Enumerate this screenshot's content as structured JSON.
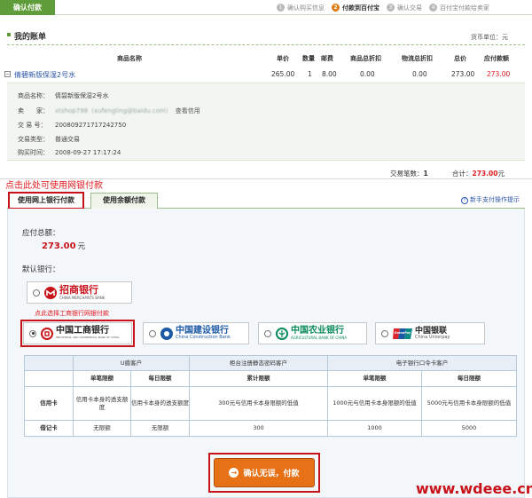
{
  "top": {
    "tab_label": "确认付款",
    "steps": [
      {
        "num": "1",
        "label": "确认购买信息",
        "active": false
      },
      {
        "num": "2",
        "label": "付款到百付宝",
        "active": true
      },
      {
        "num": "3",
        "label": "确认交易",
        "active": false
      },
      {
        "num": "4",
        "label": "百付宝付款给卖家",
        "active": false
      }
    ]
  },
  "bill": {
    "title": "我的账单",
    "currency": "货币单位：元",
    "headers": [
      "商品名称",
      "单价",
      "数量",
      "邮费",
      "商品总折扣",
      "物流总折扣",
      "总价",
      "应付款额"
    ],
    "row": {
      "expand": "−",
      "product": "倩碧新版保湿2号水",
      "price": "265.00",
      "qty": "1",
      "postage": "8.00",
      "goods_discount": "0.00",
      "logistics_discount": "0.00",
      "total": "273.00",
      "payable": "273.00"
    },
    "details": {
      "product_label": "商品名称：",
      "product_value": "倩碧新版保湿2号水",
      "seller_label": "卖　　家：",
      "seller_value": "xtshop798（xufengling@baidu.com）",
      "seller_link": "查看信用",
      "trade_no_label": "交 易 号：",
      "trade_no_value": "20080927171724275​0",
      "trade_type_label": "交易类型：",
      "trade_type_value": "普通交易",
      "buy_time_label": "购买时间：",
      "buy_time_value": "2008-09-27 17:17:24"
    },
    "summary": {
      "count_label": "交易笔数：",
      "count_value": "1",
      "sum_label": "合计：",
      "sum_value": "273.00",
      "sum_unit": "元"
    }
  },
  "hint_top": "点击此处可使用网银付款",
  "tabs": {
    "bank": "使用网上银行付款",
    "balance": "使用余额付款",
    "newbie_icon": "?",
    "newbie": "新手支付操作提示"
  },
  "pay": {
    "due_label": "应付总额：",
    "due_amount": "273.00",
    "due_unit": "元",
    "default_bank": "默认银行：",
    "hint_icbc": "点此选择工商银行网银付款",
    "banks": {
      "cmb": {
        "name": "招商银行",
        "sub": "CHINA MERCHANTS BANK"
      },
      "icbc": {
        "name": "中国工商银行",
        "sub": "INDUSTRIAL AND COMMERCIAL BANK OF CHINA"
      },
      "ccb": {
        "name": "中国建设银行",
        "sub": "China Construction Bank"
      },
      "abc": {
        "name": "中国农业银行",
        "sub": "AGRICULTURAL BANK OF CHINA"
      },
      "up": {
        "name": "中国银联",
        "sub": "China Unionpay",
        "badge": "UnionPay"
      }
    }
  },
  "limits": {
    "groups": [
      "U盾客户",
      "柜台注册静态密码客户",
      "电子银行口令卡客户"
    ],
    "sub": [
      "单笔限额",
      "每日限额",
      "累计限额",
      "单笔限额",
      "每日限额"
    ],
    "rows": [
      {
        "type": "信用卡",
        "cells": [
          "信用卡本身的透支额度",
          "信用卡本身的透支额度",
          "300元与信用卡本身限额的低值",
          "1000元与信用卡本身限额的低值",
          "5000元与信用卡本身限额的低值"
        ]
      },
      {
        "type": "借记卡",
        "cells": [
          "无限额",
          "无限额",
          "300",
          "1000",
          "5000"
        ]
      }
    ]
  },
  "confirm": {
    "label": "确认无误，付款",
    "arrow": "→"
  },
  "watermark": "www.wdeee.cn",
  "colors": {
    "brand_green": "#5f9d3a",
    "highlight_red": "#c8121a",
    "confirm_orange": "#e77117",
    "link_blue": "#2a55a8"
  }
}
